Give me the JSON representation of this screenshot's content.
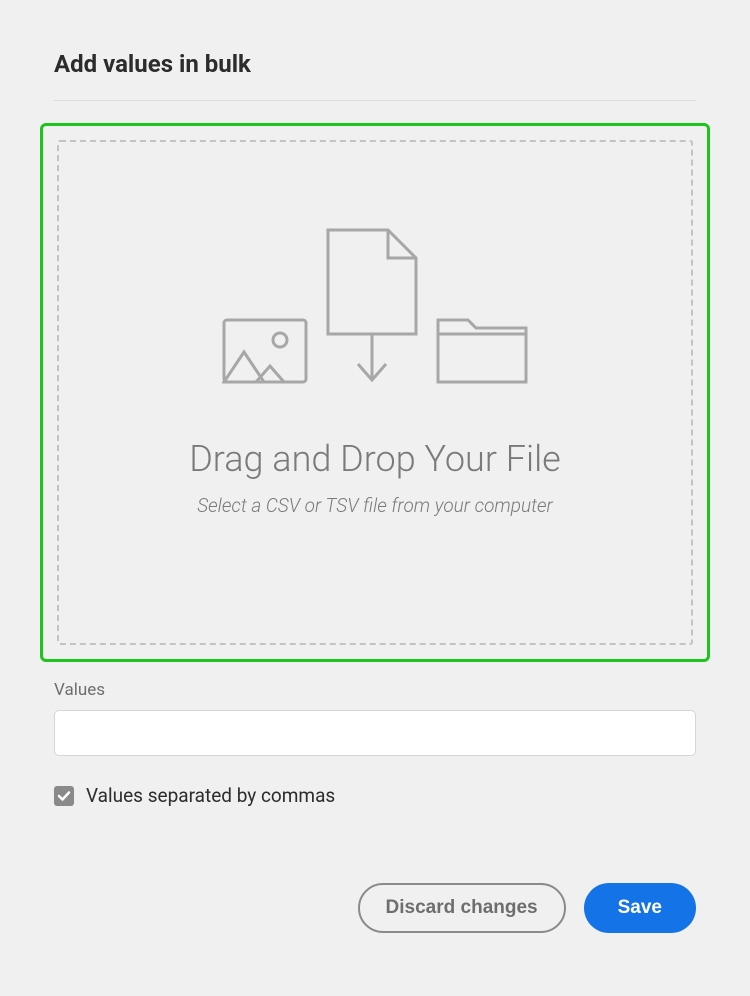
{
  "header": {
    "title": "Add values in bulk"
  },
  "dropzone": {
    "title": "Drag and Drop Your File",
    "subtitle": "Select a CSV or TSV file from your computer"
  },
  "values_field": {
    "label": "Values",
    "value": ""
  },
  "checkbox": {
    "label": "Values separated by commas",
    "checked": true
  },
  "buttons": {
    "discard": "Discard changes",
    "save": "Save"
  },
  "colors": {
    "highlight": "#1cc41c",
    "primary": "#1473e6"
  }
}
